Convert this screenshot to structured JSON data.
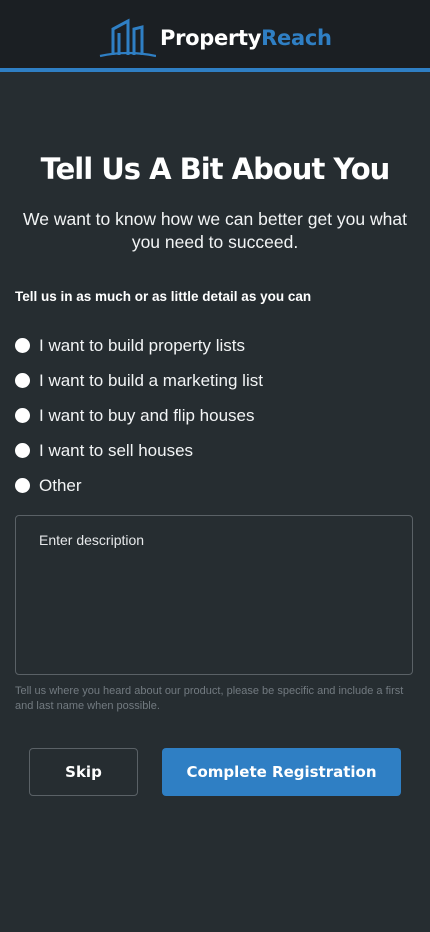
{
  "header": {
    "brand_part1": "Property",
    "brand_part2": "Reach",
    "logo_icon": "building-logo-icon",
    "accent_color": "#2f7fc4"
  },
  "main": {
    "title": "Tell Us A Bit About You",
    "subtitle": "We want to know how we can better get you what you need to succeed.",
    "hint": "Tell us in as much or as little detail as you can",
    "options": [
      {
        "label": "I want to build property lists"
      },
      {
        "label": "I want to build a marketing list"
      },
      {
        "label": "I want to buy and flip houses"
      },
      {
        "label": "I want to sell houses"
      },
      {
        "label": "Other"
      }
    ],
    "description": {
      "placeholder": "Enter description",
      "value": ""
    },
    "helper_text": "Tell us where you heard about our product, please be specific and include a first and last name when possible."
  },
  "actions": {
    "skip_label": "Skip",
    "complete_label": "Complete Registration"
  }
}
